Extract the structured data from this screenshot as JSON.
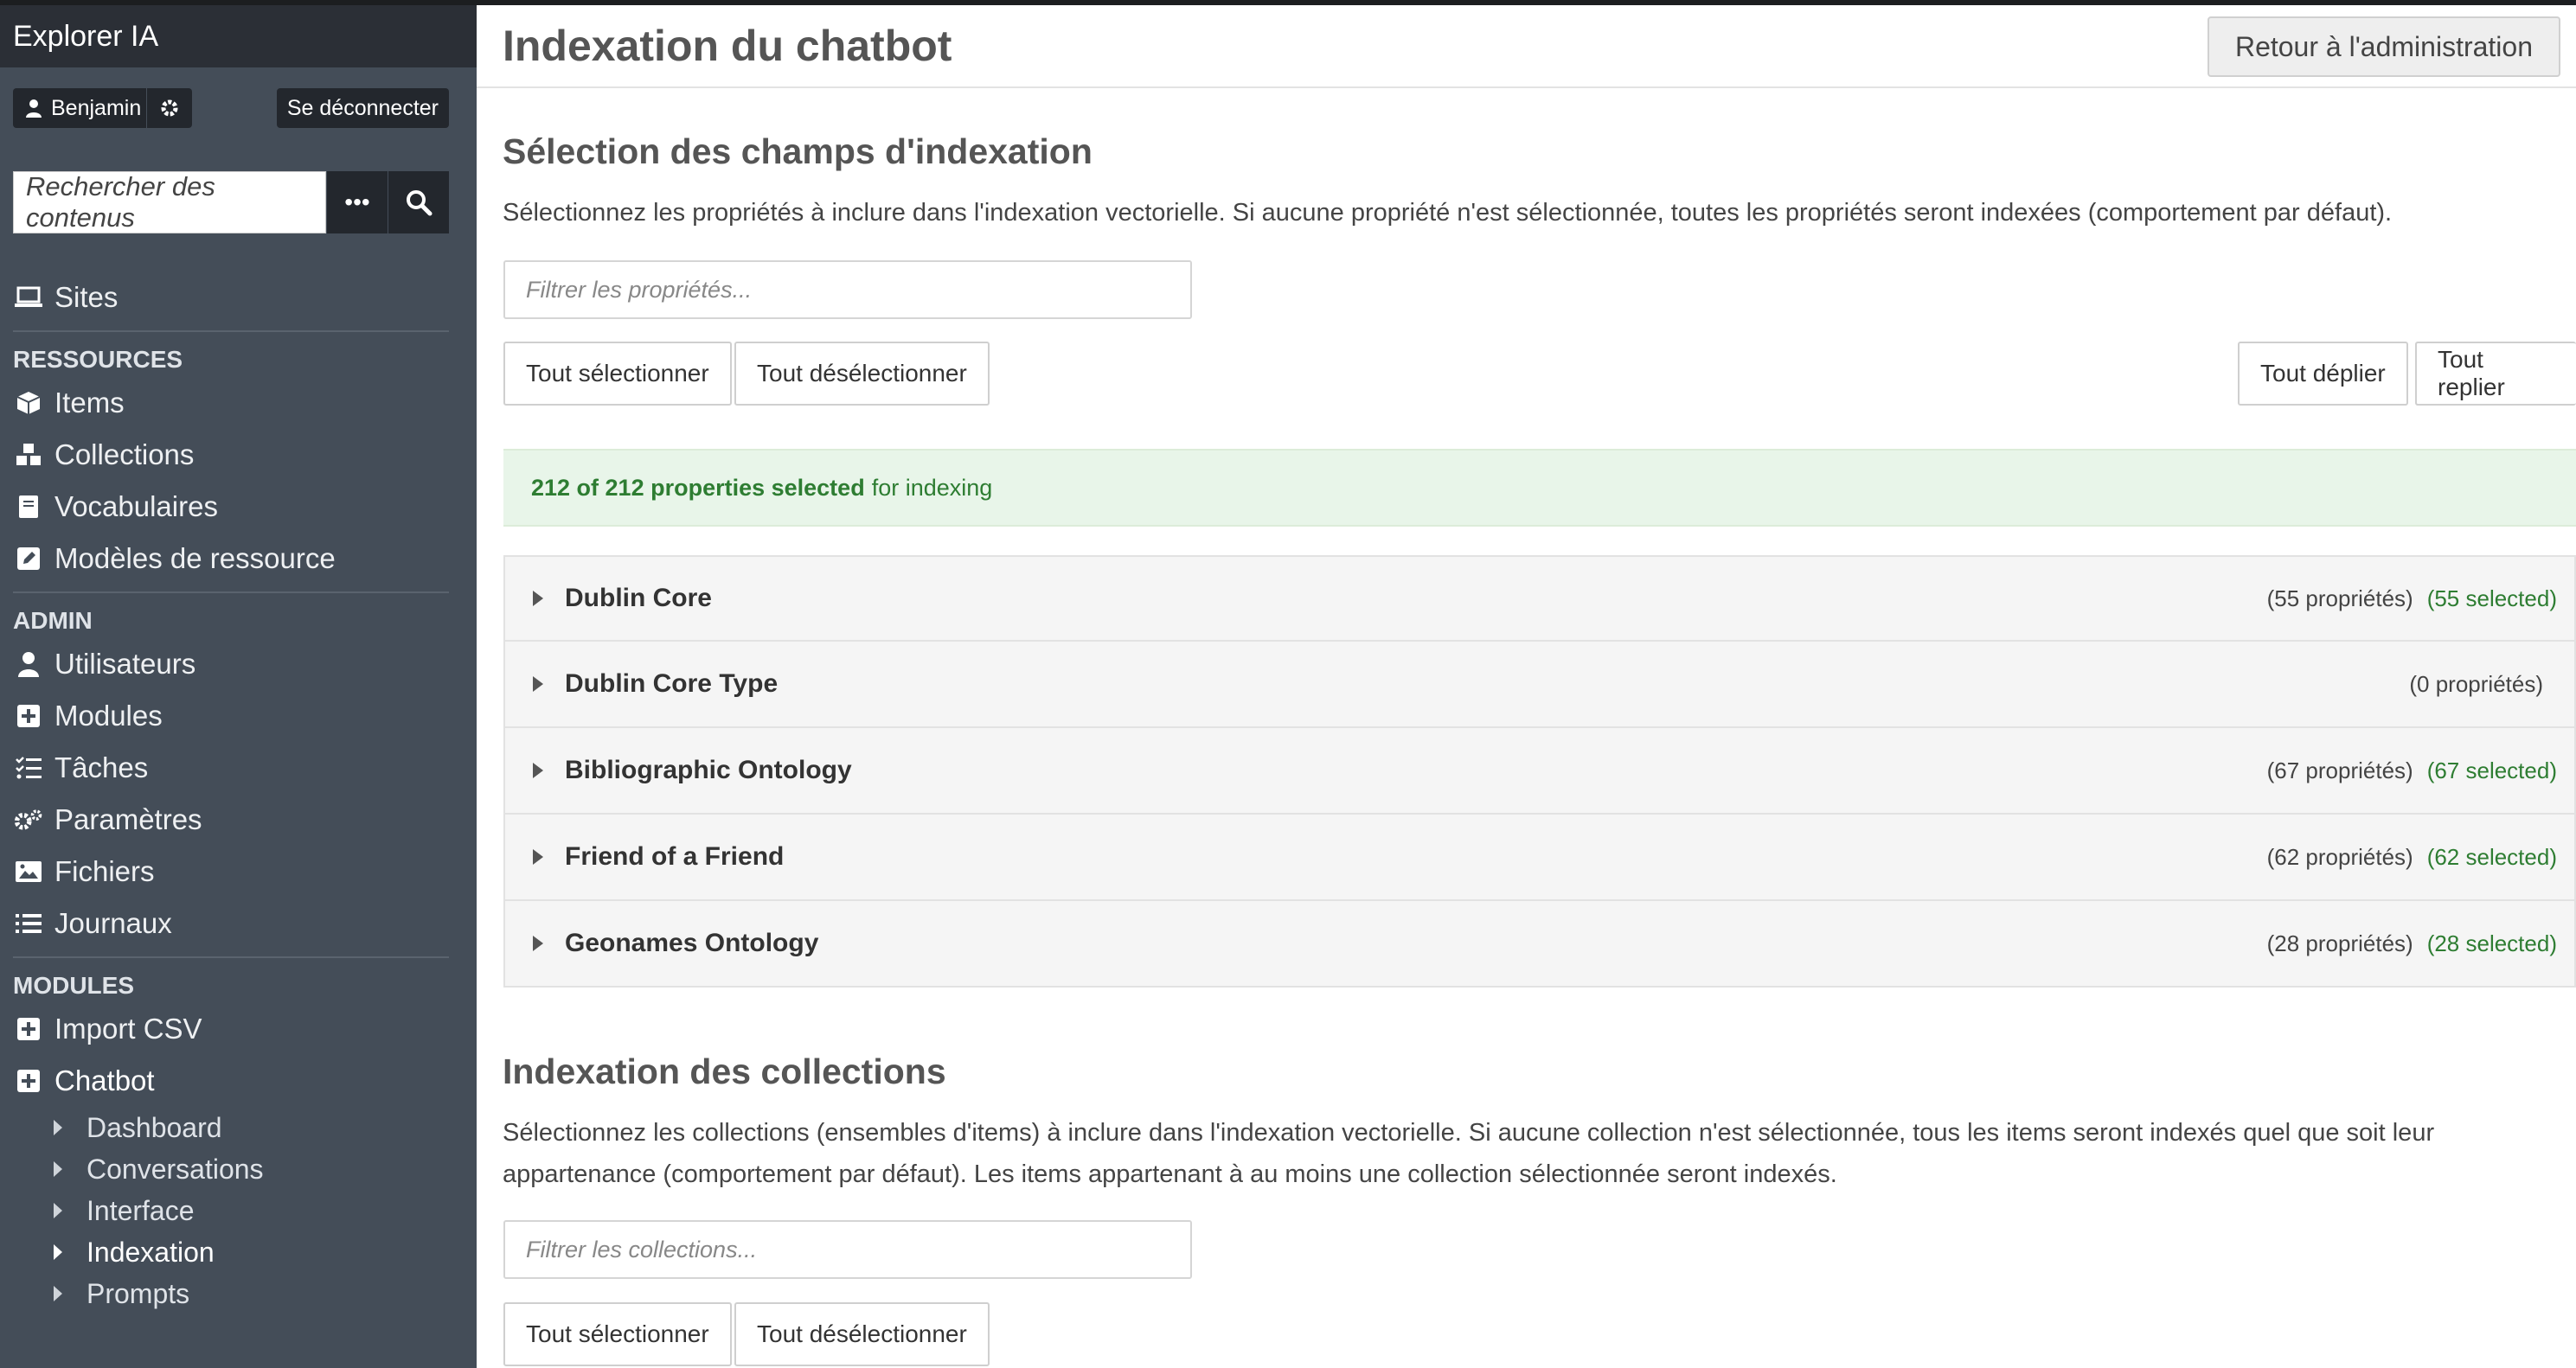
{
  "sidebar": {
    "brand": "Explorer IA",
    "user": "Benjamin",
    "logout": "Se déconnecter",
    "search_placeholder": "Rechercher des contenus",
    "sites": "Sites",
    "sections": {
      "resources": "RESSOURCES",
      "admin": "ADMIN",
      "modules": "MODULES"
    },
    "resources": [
      "Items",
      "Collections",
      "Vocabulaires",
      "Modèles de ressource"
    ],
    "admin": [
      "Utilisateurs",
      "Modules",
      "Tâches",
      "Paramètres",
      "Fichiers",
      "Journaux"
    ],
    "modules": [
      "Import CSV",
      "Chatbot"
    ],
    "chatbot_sub": [
      "Dashboard",
      "Conversations",
      "Interface",
      "Indexation",
      "Prompts"
    ]
  },
  "header": {
    "title": "Indexation du chatbot",
    "back": "Retour à l'administration"
  },
  "fields": {
    "heading": "Sélection des champs d'indexation",
    "description": "Sélectionnez les propriétés à inclure dans l'indexation vectorielle. Si aucune propriété n'est sélectionnée, toutes les propriétés seront indexées (comportement par défaut).",
    "filter_placeholder": "Filtrer les propriétés...",
    "select_all": "Tout sélectionner",
    "deselect_all": "Tout désélectionner",
    "expand_all": "Tout déplier",
    "collapse_all": "Tout replier",
    "status_bold": "212 of 212 properties selected",
    "status_rest": "for indexing",
    "vocabularies": [
      {
        "name": "Dublin Core",
        "count": "(55 propriétés)",
        "selected": "(55 selected)"
      },
      {
        "name": "Dublin Core Type",
        "count": "(0 propriétés)",
        "selected": ""
      },
      {
        "name": "Bibliographic Ontology",
        "count": "(67 propriétés)",
        "selected": "(67 selected)"
      },
      {
        "name": "Friend of a Friend",
        "count": "(62 propriétés)",
        "selected": "(62 selected)"
      },
      {
        "name": "Geonames Ontology",
        "count": "(28 propriétés)",
        "selected": "(28 selected)"
      }
    ]
  },
  "collections": {
    "heading": "Indexation des collections",
    "description": "Sélectionnez les collections (ensembles d'items) à inclure dans l'indexation vectorielle. Si aucune collection n'est sélectionnée, tous les items seront indexés quel que soit leur appartenance (comportement par défaut). Les items appartenant à au moins une collection sélectionnée seront indexés.",
    "filter_placeholder": "Filtrer les collections...",
    "select_all": "Tout sélectionner",
    "deselect_all": "Tout désélectionner"
  },
  "colors": {
    "sidebar_bg": "#444d58",
    "brand_bg": "#2b2f36",
    "success_text": "#2e7d32",
    "success_bg": "#e8f5e9"
  }
}
